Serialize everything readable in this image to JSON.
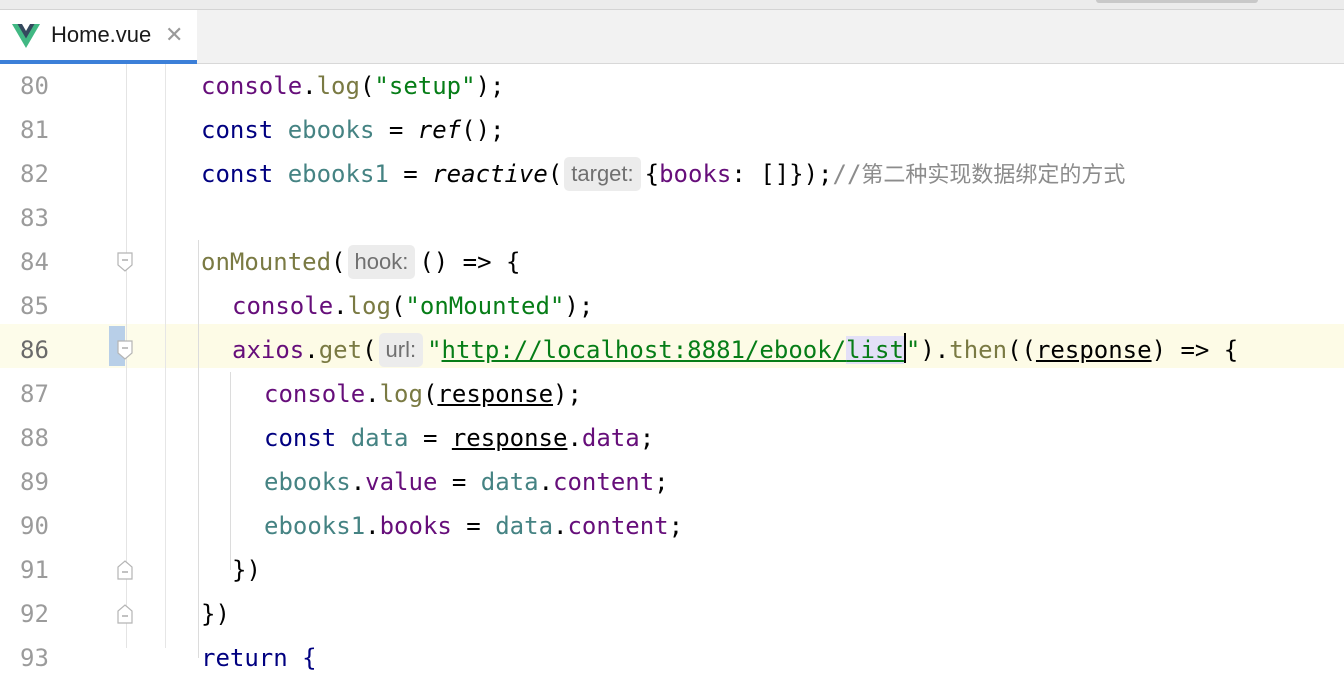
{
  "tab": {
    "filename": "Home.vue",
    "close_glyph": "✕",
    "icon": "vue-logo-icon",
    "accent": "#3c7fd8"
  },
  "editor": {
    "lines": [
      {
        "number": "80",
        "tokens": [
          {
            "t": "console",
            "c": "obj"
          },
          {
            "t": ".",
            "c": "fn"
          },
          {
            "t": "log",
            "c": "meth"
          },
          {
            "t": "(",
            "c": "fn"
          },
          {
            "t": "\"setup\"",
            "c": "str"
          },
          {
            "t": ");",
            "c": "fn"
          }
        ]
      },
      {
        "number": "81",
        "tokens": [
          {
            "t": "const ",
            "c": "kw"
          },
          {
            "t": "ebooks",
            "c": "var"
          },
          {
            "t": " = ",
            "c": "fn"
          },
          {
            "t": "ref",
            "c": "fn italic"
          },
          {
            "t": "();",
            "c": "fn"
          }
        ]
      },
      {
        "number": "82",
        "tokens": [
          {
            "t": "const ",
            "c": "kw"
          },
          {
            "t": "ebooks1",
            "c": "var"
          },
          {
            "t": " = ",
            "c": "fn"
          },
          {
            "t": "reactive",
            "c": "fn italic"
          },
          {
            "t": "(",
            "c": "fn"
          },
          {
            "t": "target:",
            "c": "hint"
          },
          {
            "t": "{",
            "c": "fn"
          },
          {
            "t": "books",
            "c": "prop"
          },
          {
            "t": ": []});",
            "c": "fn"
          },
          {
            "t": "//",
            "c": "cmt"
          },
          {
            "t": "第二种实现数据绑定的方式",
            "c": "cmt cmt-cn"
          }
        ]
      },
      {
        "number": "83",
        "tokens": []
      },
      {
        "number": "84",
        "tokens": [
          {
            "t": "onMounted",
            "c": "meth"
          },
          {
            "t": "(",
            "c": "fn"
          },
          {
            "t": "hook:",
            "c": "hint"
          },
          {
            "t": "() => {",
            "c": "fn"
          }
        ]
      },
      {
        "number": "85",
        "tokens": [
          {
            "t": "console",
            "c": "obj"
          },
          {
            "t": ".",
            "c": "fn"
          },
          {
            "t": "log",
            "c": "meth"
          },
          {
            "t": "(",
            "c": "fn"
          },
          {
            "t": "\"onMounted\"",
            "c": "str"
          },
          {
            "t": ");",
            "c": "fn"
          }
        ]
      },
      {
        "number": "86",
        "tokens": [
          {
            "t": "axios",
            "c": "obj"
          },
          {
            "t": ".",
            "c": "fn"
          },
          {
            "t": "get",
            "c": "meth"
          },
          {
            "t": "(",
            "c": "fn"
          },
          {
            "t": "url:",
            "c": "hint"
          },
          {
            "t": "\"",
            "c": "str"
          },
          {
            "t": "http://localhost:8881/ebook/",
            "c": "str ul"
          },
          {
            "t": "list",
            "c": "str ul sel"
          },
          {
            "t": "",
            "c": "caret"
          },
          {
            "t": "\"",
            "c": "str"
          },
          {
            "t": ").",
            "c": "fn"
          },
          {
            "t": "then",
            "c": "meth"
          },
          {
            "t": "((",
            "c": "fn"
          },
          {
            "t": "response",
            "c": "fn ul"
          },
          {
            "t": ") => {",
            "c": "fn"
          }
        ]
      },
      {
        "number": "87",
        "tokens": [
          {
            "t": "console",
            "c": "obj"
          },
          {
            "t": ".",
            "c": "fn"
          },
          {
            "t": "log",
            "c": "meth"
          },
          {
            "t": "(",
            "c": "fn"
          },
          {
            "t": "response",
            "c": "fn ul"
          },
          {
            "t": ");",
            "c": "fn"
          }
        ]
      },
      {
        "number": "88",
        "tokens": [
          {
            "t": "const ",
            "c": "kw"
          },
          {
            "t": "data",
            "c": "var"
          },
          {
            "t": " = ",
            "c": "fn"
          },
          {
            "t": "response",
            "c": "fn ul"
          },
          {
            "t": ".",
            "c": "fn"
          },
          {
            "t": "data",
            "c": "prop"
          },
          {
            "t": ";",
            "c": "fn"
          }
        ]
      },
      {
        "number": "89",
        "tokens": [
          {
            "t": "ebooks",
            "c": "var"
          },
          {
            "t": ".",
            "c": "fn"
          },
          {
            "t": "value",
            "c": "prop"
          },
          {
            "t": " = ",
            "c": "fn"
          },
          {
            "t": "data",
            "c": "var"
          },
          {
            "t": ".",
            "c": "fn"
          },
          {
            "t": "content",
            "c": "prop"
          },
          {
            "t": ";",
            "c": "fn"
          }
        ]
      },
      {
        "number": "90",
        "tokens": [
          {
            "t": "ebooks1",
            "c": "var"
          },
          {
            "t": ".",
            "c": "fn"
          },
          {
            "t": "books",
            "c": "prop"
          },
          {
            "t": " = ",
            "c": "fn"
          },
          {
            "t": "data",
            "c": "var"
          },
          {
            "t": ".",
            "c": "fn"
          },
          {
            "t": "content",
            "c": "prop"
          },
          {
            "t": ";",
            "c": "fn"
          }
        ]
      },
      {
        "number": "91",
        "tokens": [
          {
            "t": "})",
            "c": "fn"
          }
        ]
      },
      {
        "number": "92",
        "tokens": [
          {
            "t": "})",
            "c": "fn"
          }
        ]
      },
      {
        "number": "93",
        "tokens": [
          {
            "t": "return {",
            "c": "kw"
          }
        ]
      }
    ]
  }
}
